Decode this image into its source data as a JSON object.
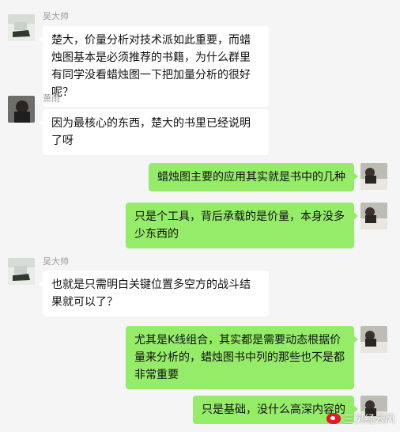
{
  "messages": [
    {
      "side": "left",
      "name": "吴大帅",
      "text": "楚大，价量分析对技术派如此重要，而蜡烛图基本是必须推荐的书籍，为什么群里有同学没看蜡烛图一下把加量分析的很好呢？"
    },
    {
      "side": "left",
      "name": "萧雨",
      "text": "因为最核心的东西，楚大的书里已经说明了呀"
    },
    {
      "side": "right",
      "text": "蜡烛图主要的应用其实就是书中的几种"
    },
    {
      "side": "right",
      "text": "只是个工具，背后承载的是价量，本身没多少东西的"
    },
    {
      "side": "left",
      "name": "吴大帅",
      "text": "也就是只需明白关键位置多空方的战斗结果就可以了？"
    },
    {
      "side": "right",
      "text": "尤其是K线组合，其实都是需要动态根据价量来分析的，蜡烛图书中列的那些也不是都非常重要"
    },
    {
      "side": "right",
      "text": "只是基础，没什么高深内容的"
    }
  ],
  "watermark": {
    "text": "三灵经云风"
  },
  "colors": {
    "bg": "#f5f5f5",
    "right_bubble": "#95ec69",
    "left_bubble": "#ffffff"
  }
}
